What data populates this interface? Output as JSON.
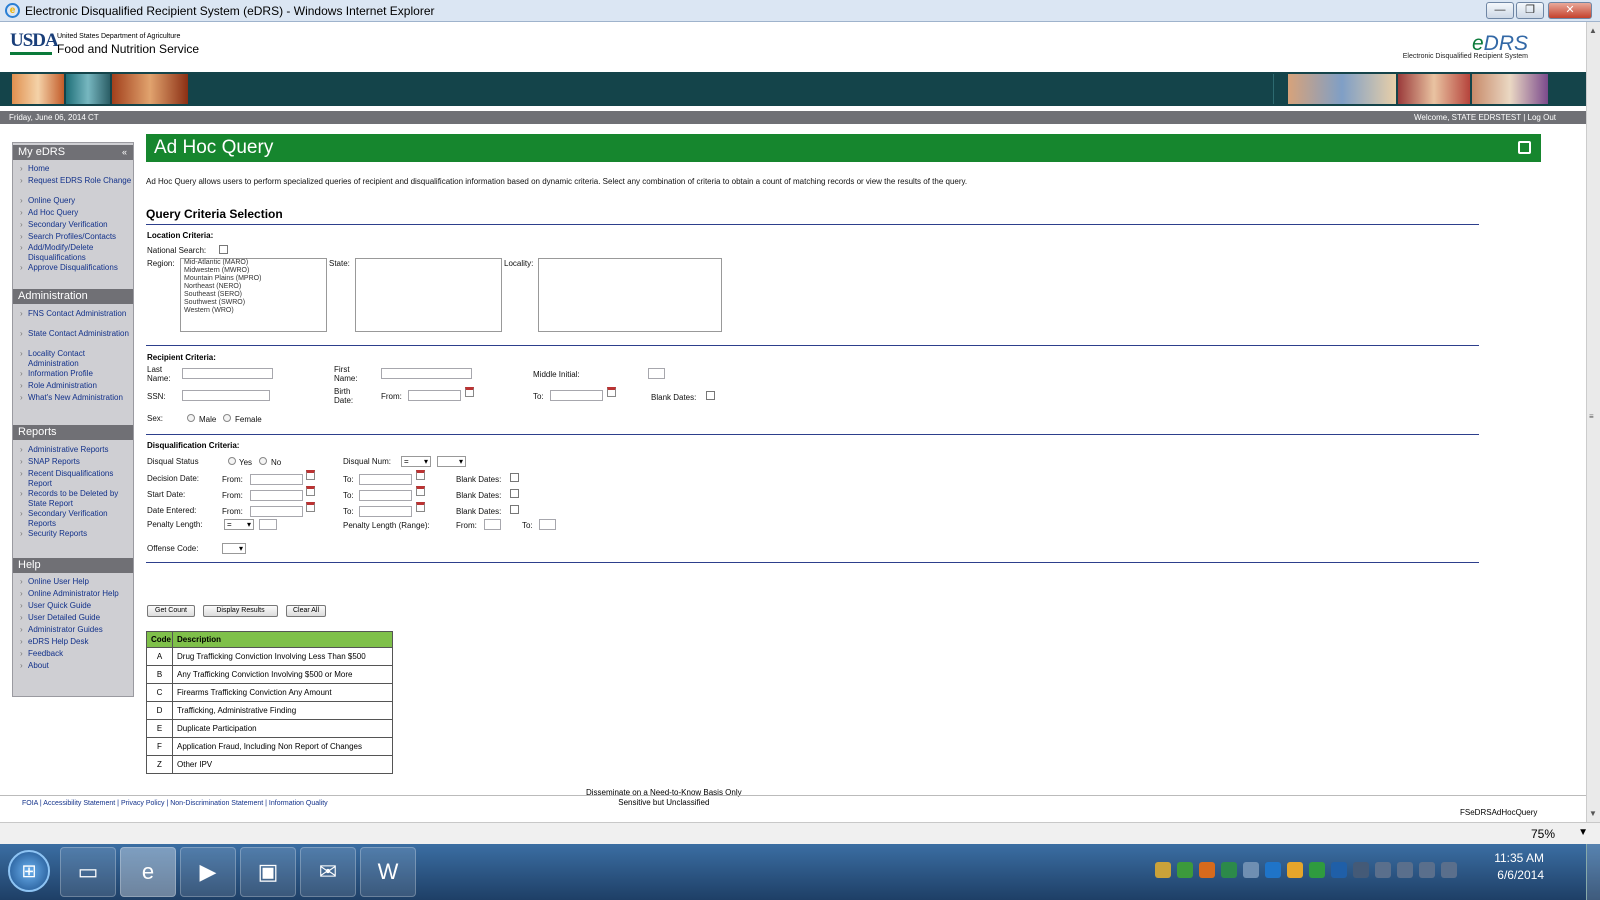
{
  "window": {
    "title": "Electronic Disqualified Recipient System (eDRS) - Windows Internet Explorer",
    "minimize": "—",
    "restore": "❐",
    "close": "✕"
  },
  "header": {
    "usda": "USDA",
    "dept": "United States Department of Agriculture",
    "agency": "Food and Nutrition Service",
    "edrs_e": "e",
    "edrs_rest": "DRS",
    "edrs_sub": "Electronic Disqualified Recipient System",
    "date": "Friday, June 06, 2014 CT",
    "welcome": "Welcome, STATE EDRSTEST | Log Out"
  },
  "sidebar": {
    "my_edrs": {
      "title": "My eDRS",
      "collapse": "«",
      "items": [
        "Home",
        "Request EDRS Role Change",
        "Online Query",
        "Ad Hoc Query",
        "Secondary Verification",
        "Search Profiles/Contacts",
        "Add/Modify/Delete Disqualifications",
        "Approve Disqualifications"
      ]
    },
    "administration": {
      "title": "Administration",
      "items": [
        "FNS Contact Administration",
        "State Contact Administration",
        "Locality Contact Administration",
        "Information Profile",
        "Role Administration",
        "What's New Administration"
      ]
    },
    "reports": {
      "title": "Reports",
      "items": [
        "Administrative Reports",
        "SNAP Reports",
        "Recent Disqualifications Report",
        "Records to be Deleted by State Report",
        "Secondary Verification Reports",
        "Security Reports"
      ]
    },
    "help": {
      "title": "Help",
      "items": [
        "Online User Help",
        "Online Administrator Help",
        "User Quick Guide",
        "User Detailed Guide",
        "Administrator Guides",
        "eDRS Help Desk",
        "Feedback",
        "About"
      ]
    }
  },
  "main": {
    "title": "Ad Hoc Query",
    "description": "Ad Hoc Query allows users to perform specialized queries of recipient and disqualification information based on dynamic criteria. Select any combination of criteria to obtain a count of matching records or view the results of the query.",
    "section": "Query Criteria Selection",
    "location": {
      "heading": "Location Criteria:",
      "national": "National Search:",
      "region": "Region:",
      "state": "State:",
      "locality": "Locality:",
      "regions": [
        "Mid-Atlantic (MARO)",
        "Midwestern (MWRO)",
        "Mountain Plains (MPRO)",
        "Northeast (NERO)",
        "Southeast (SERO)",
        "Southwest (SWRO)",
        "Western (WRO)"
      ]
    },
    "recipient": {
      "heading": "Recipient Criteria:",
      "last_a": "Last",
      "last_b": "Name:",
      "first_a": "First",
      "first_b": "Name:",
      "middle": "Middle Initial:",
      "ssn": "SSN:",
      "birth_a": "Birth",
      "birth_b": "Date:",
      "from": "From:",
      "to": "To:",
      "blank": "Blank Dates:",
      "sex": "Sex:",
      "male": "Male",
      "female": "Female"
    },
    "disqual": {
      "heading": "Disqualification Criteria:",
      "status": "Disqual Status",
      "yes": "Yes",
      "no": "No",
      "num": "Disqual Num:",
      "num_op": "=",
      "decision": "Decision Date:",
      "start": "Start Date:",
      "entered": "Date Entered:",
      "from": "From:",
      "to": "To:",
      "blank": "Blank Dates:",
      "penalty": "Penalty Length:",
      "penalty_op": "=",
      "penalty_range": "Penalty Length (Range):",
      "offense": "Offense Code:"
    },
    "buttons": {
      "count": "Get Count",
      "display": "Display Results",
      "clear": "Clear All"
    },
    "offense_table": {
      "headers": [
        "Code",
        "Description"
      ],
      "rows": [
        [
          "A",
          "Drug Trafficking Conviction Involving Less Than $500"
        ],
        [
          "B",
          "Any Trafficking Conviction Involving $500 or More"
        ],
        [
          "C",
          "Firearms Trafficking Conviction Any Amount"
        ],
        [
          "D",
          "Trafficking, Administrative Finding"
        ],
        [
          "E",
          "Duplicate Participation"
        ],
        [
          "F",
          "Application Fraud, Including Non Report of Changes"
        ],
        [
          "Z",
          "Other IPV"
        ]
      ]
    },
    "disseminate1": "Disseminate on a Need-to-Know Basis Only",
    "disseminate2": "Sensitive but Unclassified",
    "page_id": "FSeDRSAdHocQuery"
  },
  "footer": {
    "links": "FOIA | Accessibility Statement | Privacy Policy | Non-Discrimination Statement | Information Quality"
  },
  "statusbar": {
    "zoom": "75%"
  },
  "taskbar": {
    "time": "11:35 AM",
    "date": "6/6/2014"
  },
  "colors": {
    "heading_green": "#16862e",
    "table_header_green": "#7fc04a",
    "link_blue": "#12318a",
    "banner": "#14444a"
  }
}
